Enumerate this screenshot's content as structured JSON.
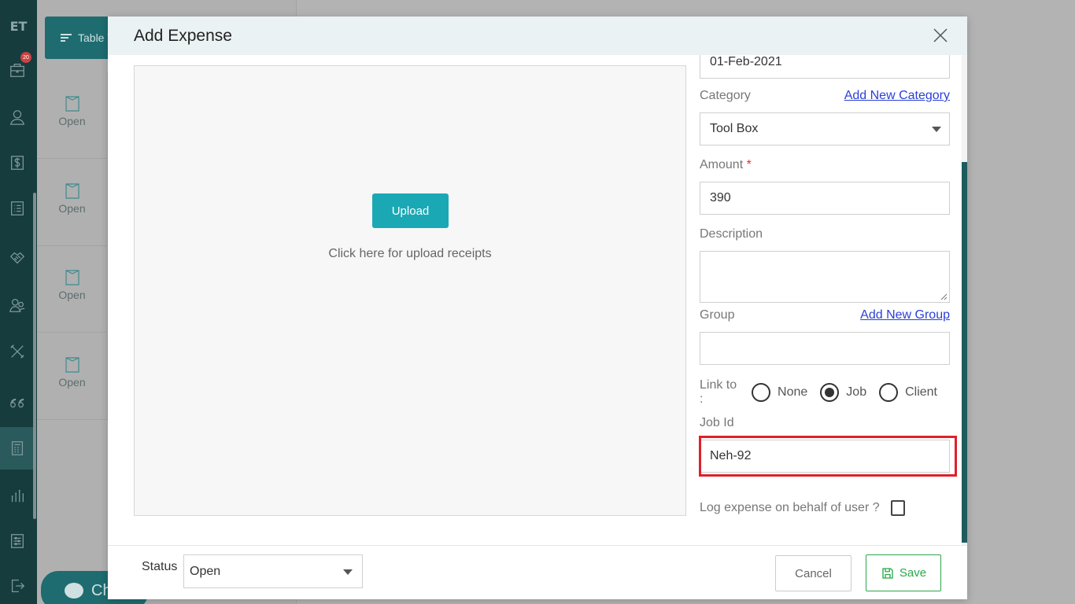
{
  "app": {
    "logo_text": "ET",
    "notification_count": "20"
  },
  "sidebar": {
    "items": [
      {
        "name": "briefcase-icon"
      },
      {
        "name": "user-icon"
      },
      {
        "name": "dollar-icon"
      },
      {
        "name": "list-icon"
      },
      {
        "name": "handshake-icon"
      },
      {
        "name": "team-icon"
      },
      {
        "name": "tools-icon"
      },
      {
        "name": "quote-icon"
      },
      {
        "name": "calculator-icon"
      },
      {
        "name": "chart-icon"
      },
      {
        "name": "settings-icon"
      },
      {
        "name": "logout-icon"
      }
    ]
  },
  "background": {
    "table_view_label": "Table V",
    "rows": [
      {
        "status": "Open"
      },
      {
        "status": "Open"
      },
      {
        "status": "Open"
      },
      {
        "status": "Open"
      }
    ],
    "chat_label": "Ch"
  },
  "modal": {
    "title": "Add Expense",
    "upload": {
      "button_label": "Upload",
      "hint": "Click here for upload receipts"
    },
    "form": {
      "date_value": "01-Feb-2021",
      "category_label": "Category",
      "add_category_link": "Add New Category",
      "category_value": "Tool Box",
      "amount_label": "Amount",
      "amount_required_mark": "*",
      "amount_value": "390",
      "description_label": "Description",
      "description_value": "",
      "group_label": "Group",
      "add_group_link": "Add New Group",
      "group_value": "",
      "link_to_label": "Link to :",
      "link_options": [
        "None",
        "Job",
        "Client"
      ],
      "link_selected": "Job",
      "job_id_label": "Job Id",
      "job_id_value": "Neh-92",
      "behalf_label": "Log expense on behalf of user ?",
      "behalf_checked": false
    },
    "footer": {
      "status_label": "Status",
      "status_value": "Open",
      "cancel_label": "Cancel",
      "save_label": "Save"
    }
  },
  "colors": {
    "sidebar_bg": "#163c3e",
    "accent_teal": "#1ba8b5",
    "save_green": "#2aa84a",
    "highlight_red": "#e0202a",
    "link_blue": "#2b3fd6"
  }
}
